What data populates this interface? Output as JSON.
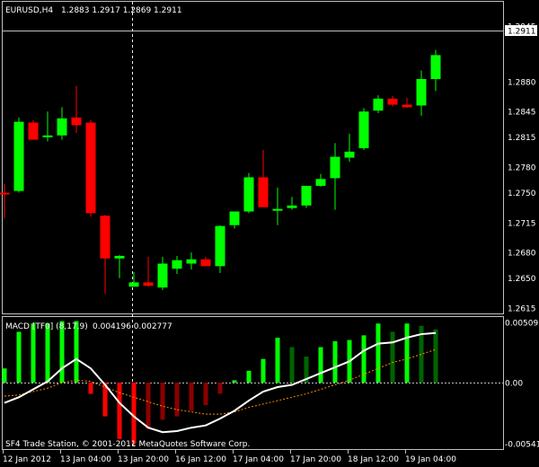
{
  "symbol_header": {
    "symbol": "EURUSD,H4",
    "quote": "1.2883 1.2917 1.2869 1.2911"
  },
  "colors": {
    "bull": "#00ff00",
    "bear": "#ff0000",
    "hist_pos_strong": "#00ff00",
    "hist_pos_weak": "#006400",
    "hist_neg_strong": "#ff0000",
    "hist_neg_weak": "#8b0000",
    "macd_line": "#ffffff",
    "signal_line": "#ff8c00",
    "grid_frame": "#c0c0c0",
    "background": "#000000"
  },
  "price_axis": {
    "labels": [
      "1.2945",
      "1.2880",
      "1.2845",
      "1.2815",
      "1.2780",
      "1.2750",
      "1.2715",
      "1.2680",
      "1.2650",
      "1.2615"
    ],
    "current_price_label": "1.2911"
  },
  "indicator": {
    "title": "MACD [TF0] (8,17,9)",
    "values": "0.004196 0.002777",
    "axis_labels": [
      "0.005093",
      "0.00",
      "-0.005418"
    ]
  },
  "time_axis": {
    "labels": [
      "12 Jan 2012",
      "13 Jan 04:00",
      "13 Jan 20:00",
      "16 Jan 12:00",
      "17 Jan 04:00",
      "17 Jan 20:00",
      "18 Jan 12:00",
      "19 Jan 04:00"
    ]
  },
  "footer": {
    "copyright": "SF4 Trade Station, © 2001-2011 MetaQuotes Software Corp."
  },
  "chart_data": {
    "type": "candlestick",
    "timeframe": "H4",
    "candles": [
      {
        "o": 1.275,
        "h": 1.276,
        "l": 1.272,
        "c": 1.2748
      },
      {
        "o": 1.2752,
        "h": 1.2838,
        "l": 1.275,
        "c": 1.2833
      },
      {
        "o": 1.2832,
        "h": 1.2835,
        "l": 1.2812,
        "c": 1.2812
      },
      {
        "o": 1.2815,
        "h": 1.2845,
        "l": 1.281,
        "c": 1.2817
      },
      {
        "o": 1.2817,
        "h": 1.285,
        "l": 1.2812,
        "c": 1.2837
      },
      {
        "o": 1.2838,
        "h": 1.2875,
        "l": 1.282,
        "c": 1.2829
      },
      {
        "o": 1.2832,
        "h": 1.2835,
        "l": 1.2722,
        "c": 1.2726
      },
      {
        "o": 1.2723,
        "h": 1.2724,
        "l": 1.2632,
        "c": 1.2673
      },
      {
        "o": 1.2673,
        "h": 1.2677,
        "l": 1.265,
        "c": 1.2676
      },
      {
        "o": 1.264,
        "h": 1.2657,
        "l": 1.264,
        "c": 1.2645
      },
      {
        "o": 1.2645,
        "h": 1.2675,
        "l": 1.264,
        "c": 1.2641
      },
      {
        "o": 1.2639,
        "h": 1.2675,
        "l": 1.2636,
        "c": 1.2667
      },
      {
        "o": 1.2661,
        "h": 1.2676,
        "l": 1.2655,
        "c": 1.2671
      },
      {
        "o": 1.2667,
        "h": 1.268,
        "l": 1.266,
        "c": 1.2672
      },
      {
        "o": 1.2672,
        "h": 1.2675,
        "l": 1.2664,
        "c": 1.2664
      },
      {
        "o": 1.2664,
        "h": 1.2712,
        "l": 1.2656,
        "c": 1.2711
      },
      {
        "o": 1.2712,
        "h": 1.2728,
        "l": 1.2708,
        "c": 1.2728
      },
      {
        "o": 1.2728,
        "h": 1.2773,
        "l": 1.2726,
        "c": 1.2768
      },
      {
        "o": 1.2768,
        "h": 1.28,
        "l": 1.2736,
        "c": 1.2733
      },
      {
        "o": 1.2731,
        "h": 1.2756,
        "l": 1.2712,
        "c": 1.2731
      },
      {
        "o": 1.2732,
        "h": 1.2745,
        "l": 1.273,
        "c": 1.2735
      },
      {
        "o": 1.2735,
        "h": 1.2758,
        "l": 1.2732,
        "c": 1.2758
      },
      {
        "o": 1.2758,
        "h": 1.2772,
        "l": 1.2757,
        "c": 1.2766
      },
      {
        "o": 1.2767,
        "h": 1.2808,
        "l": 1.273,
        "c": 1.2792
      },
      {
        "o": 1.2791,
        "h": 1.2819,
        "l": 1.2786,
        "c": 1.2798
      },
      {
        "o": 1.2802,
        "h": 1.2849,
        "l": 1.28,
        "c": 1.2845
      },
      {
        "o": 1.2846,
        "h": 1.2864,
        "l": 1.2843,
        "c": 1.286
      },
      {
        "o": 1.286,
        "h": 1.2863,
        "l": 1.2851,
        "c": 1.2853
      },
      {
        "o": 1.2853,
        "h": 1.2861,
        "l": 1.2849,
        "c": 1.285
      },
      {
        "o": 1.2852,
        "h": 1.2893,
        "l": 1.284,
        "c": 1.2883
      },
      {
        "o": 1.2883,
        "h": 1.2917,
        "l": 1.2869,
        "c": 1.2911
      }
    ],
    "macd": {
      "histogram": [
        0.0012,
        0.0043,
        0.005,
        0.005,
        0.0052,
        0.0052,
        -0.001,
        -0.003,
        -0.005,
        -0.0054,
        -0.0041,
        -0.0033,
        -0.003,
        -0.0025,
        -0.002,
        -0.001,
        0.0002,
        0.001,
        0.002,
        0.0038,
        0.003,
        0.0022,
        0.003,
        0.0035,
        0.0036,
        0.004,
        0.005,
        0.0043,
        0.005,
        0.0048,
        0.0045
      ],
      "macd_line": [
        -0.0018,
        -0.0013,
        -0.0006,
        0.0001,
        0.0012,
        0.002,
        0.0012,
        -0.0002,
        -0.0018,
        -0.003,
        -0.004,
        -0.0044,
        -0.0043,
        -0.004,
        -0.0038,
        -0.0032,
        -0.0025,
        -0.0016,
        -0.0008,
        -0.0004,
        -0.0002,
        0.0003,
        0.0008,
        0.0013,
        0.0018,
        0.0027,
        0.0033,
        0.0034,
        0.0038,
        0.0041,
        0.0042
      ],
      "signal_line": [
        -0.0012,
        -0.0011,
        -0.0008,
        -0.0005,
        0.0,
        0.0002,
        0.0001,
        -0.0004,
        -0.0009,
        -0.0013,
        -0.0017,
        -0.0021,
        -0.0024,
        -0.0026,
        -0.0028,
        -0.0028,
        -0.0026,
        -0.0022,
        -0.0019,
        -0.0016,
        -0.0013,
        -0.001,
        -0.0006,
        -0.0002,
        0.0002,
        0.0007,
        0.0012,
        0.0017,
        0.002,
        0.0024,
        0.0028
      ]
    },
    "price_ylim": [
      1.2605,
      1.2955
    ],
    "macd_ylim": [
      -0.0054,
      0.0051
    ],
    "grid": false
  }
}
